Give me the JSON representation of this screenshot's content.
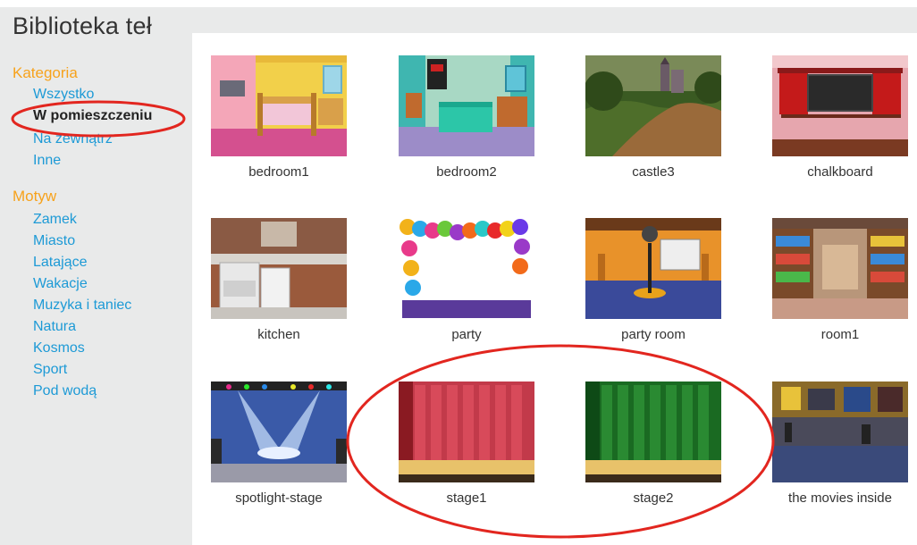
{
  "page_title": "Biblioteka teł",
  "sidebar": {
    "category_heading": "Kategoria",
    "categories": [
      {
        "label": "Wszystko",
        "selected": false
      },
      {
        "label": "W pomieszczeniu",
        "selected": true
      },
      {
        "label": "Na zewnątrz",
        "selected": false
      },
      {
        "label": "Inne",
        "selected": false
      }
    ],
    "theme_heading": "Motyw",
    "themes": [
      {
        "label": "Zamek"
      },
      {
        "label": "Miasto"
      },
      {
        "label": "Latające"
      },
      {
        "label": "Wakacje"
      },
      {
        "label": "Muzyka i taniec"
      },
      {
        "label": "Natura"
      },
      {
        "label": "Kosmos"
      },
      {
        "label": "Sport"
      },
      {
        "label": "Pod wodą"
      }
    ]
  },
  "backdrops": [
    {
      "name": "bedroom1"
    },
    {
      "name": "bedroom2"
    },
    {
      "name": "castle3"
    },
    {
      "name": "chalkboard"
    },
    {
      "name": "kitchen"
    },
    {
      "name": "party"
    },
    {
      "name": "party room"
    },
    {
      "name": "room1"
    },
    {
      "name": "spotlight-stage"
    },
    {
      "name": "stage1"
    },
    {
      "name": "stage2"
    },
    {
      "name": "the movies inside"
    }
  ],
  "colors": {
    "heading_orange": "#f7a21b",
    "link_blue": "#1d9ad6",
    "annotation_red": "#e2261f",
    "panel_gray": "#e9eaea"
  }
}
